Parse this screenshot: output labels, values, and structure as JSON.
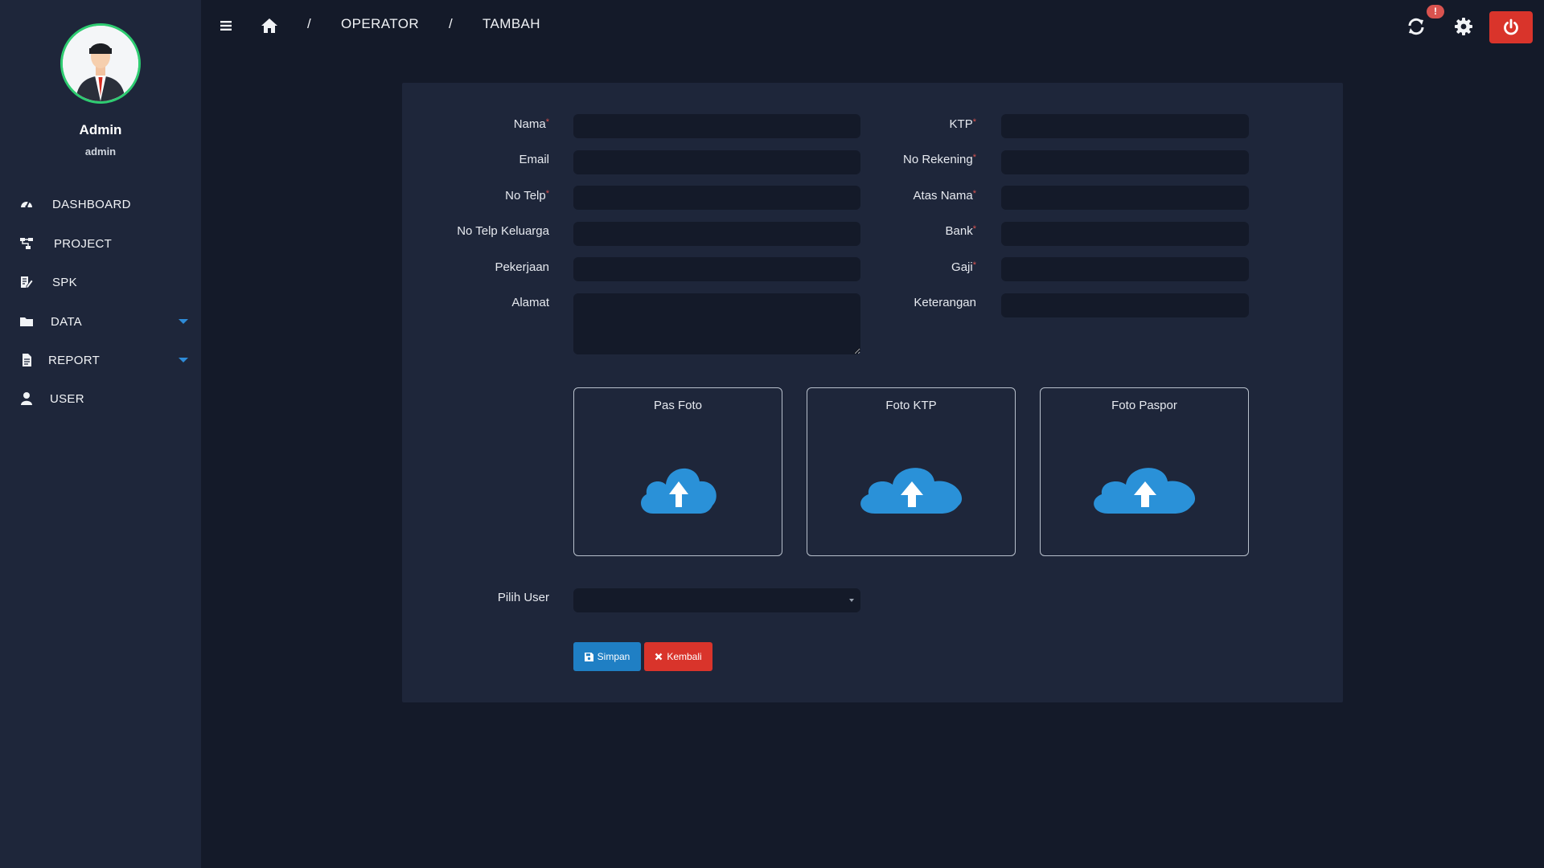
{
  "user": {
    "name": "Admin",
    "role": "admin"
  },
  "nav": [
    {
      "label": "DASHBOARD",
      "icon": "dashboard-icon"
    },
    {
      "label": "PROJECT",
      "icon": "sitemap-icon"
    },
    {
      "label": "SPK",
      "icon": "edit-document-icon"
    },
    {
      "label": "DATA",
      "icon": "folder-icon",
      "has_submenu": true
    },
    {
      "label": "REPORT",
      "icon": "file-icon",
      "has_submenu": true
    },
    {
      "label": "USER",
      "icon": "user-icon"
    }
  ],
  "breadcrumb": {
    "sep1": "/",
    "item1": "OPERATOR",
    "sep2": "/",
    "item2": "TAMBAH"
  },
  "topbar": {
    "notification_badge": "!"
  },
  "form": {
    "left": {
      "nama": {
        "label": "Nama",
        "required": "*",
        "value": ""
      },
      "email": {
        "label": "Email",
        "value": ""
      },
      "no_telp": {
        "label": "No Telp",
        "required": "*",
        "value": ""
      },
      "no_telp_keluarga": {
        "label": "No Telp Keluarga",
        "value": ""
      },
      "pekerjaan": {
        "label": "Pekerjaan",
        "value": ""
      },
      "alamat": {
        "label": "Alamat",
        "value": ""
      }
    },
    "right": {
      "ktp": {
        "label": "KTP",
        "required": "*",
        "value": ""
      },
      "no_rekening": {
        "label": "No Rekening",
        "required": "*",
        "value": ""
      },
      "atas_nama": {
        "label": "Atas Nama",
        "required": "*",
        "value": ""
      },
      "bank": {
        "label": "Bank",
        "required": "*",
        "value": ""
      },
      "gaji": {
        "label": "Gaji",
        "required": "*",
        "value": ""
      },
      "keterangan": {
        "label": "Keterangan",
        "value": ""
      }
    },
    "uploads": {
      "pas_foto": "Pas Foto",
      "foto_ktp": "Foto KTP",
      "foto_paspor": "Foto Paspor"
    },
    "pilih_user": {
      "label": "Pilih User",
      "selected": ""
    },
    "buttons": {
      "save": "Simpan",
      "back": "Kembali"
    }
  },
  "colors": {
    "background": "#141a29",
    "panel": "#1e263a",
    "accent_green": "#2ecc71",
    "primary": "#1f7fc4",
    "danger": "#d9342b",
    "required": "#d9534f"
  }
}
